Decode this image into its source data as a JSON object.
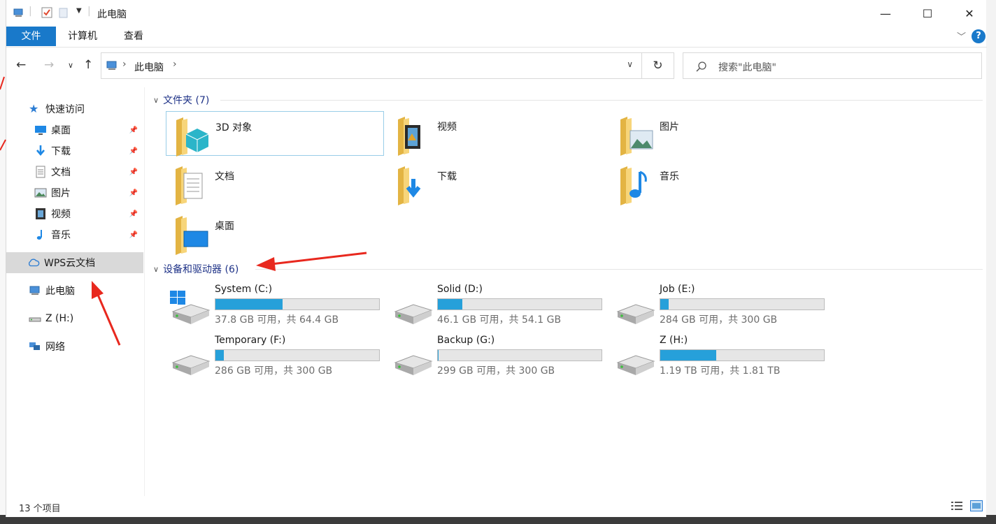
{
  "window": {
    "title": "此电脑",
    "controls": {
      "minimize": "—",
      "maximize": "☐",
      "close": "✕"
    }
  },
  "ribbon": {
    "tabs": [
      "文件",
      "计算机",
      "查看"
    ],
    "help": "?"
  },
  "address": {
    "path": "此电脑",
    "search_placeholder": "搜索\"此电脑\""
  },
  "nav_pane": {
    "quick_access": "快速访问",
    "items": [
      {
        "label": "桌面",
        "icon": "desktop-icon",
        "pinned": true
      },
      {
        "label": "下载",
        "icon": "download-icon",
        "pinned": true
      },
      {
        "label": "文档",
        "icon": "document-icon",
        "pinned": true
      },
      {
        "label": "图片",
        "icon": "picture-icon",
        "pinned": true
      },
      {
        "label": "视频",
        "icon": "video-icon",
        "pinned": true
      },
      {
        "label": "音乐",
        "icon": "music-icon",
        "pinned": true
      }
    ],
    "wps": "WPS云文档",
    "this_pc": "此电脑",
    "z_drive": "Z (H:)",
    "network": "网络"
  },
  "folders": {
    "header": "文件夹 (7)",
    "items": [
      "3D 对象",
      "视频",
      "图片",
      "文档",
      "下载",
      "音乐",
      "桌面"
    ]
  },
  "drives": {
    "header": "设备和驱动器 (6)",
    "items": [
      {
        "name": "System (C:)",
        "detail": "37.8 GB 可用，共 64.4 GB",
        "used_fraction": 0.41
      },
      {
        "name": "Solid (D:)",
        "detail": "46.1 GB 可用，共 54.1 GB",
        "used_fraction": 0.15
      },
      {
        "name": "Job (E:)",
        "detail": "284 GB 可用，共 300 GB",
        "used_fraction": 0.05
      },
      {
        "name": "Temporary (F:)",
        "detail": "286 GB 可用，共 300 GB",
        "used_fraction": 0.05
      },
      {
        "name": "Backup (G:)",
        "detail": "299 GB 可用，共 300 GB",
        "used_fraction": 0.003
      },
      {
        "name": "Z (H:)",
        "detail": "1.19 TB 可用，共 1.81 TB",
        "used_fraction": 0.34
      }
    ]
  },
  "status": {
    "count": "13 个项目"
  },
  "colors": {
    "accent": "#1979ca",
    "drive_fill": "#26a0da",
    "annotation": "#e8281e"
  }
}
